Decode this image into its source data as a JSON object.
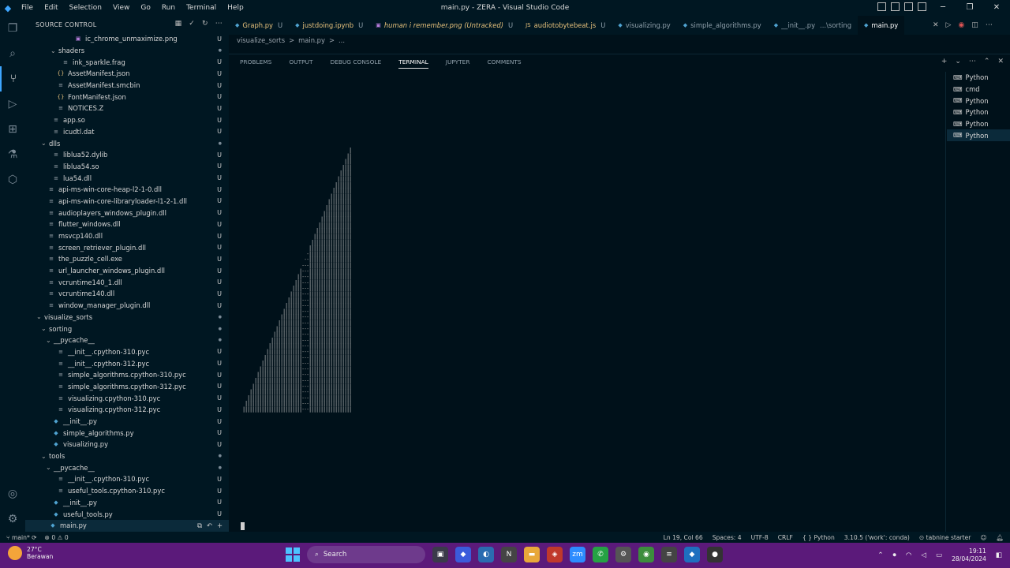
{
  "titlebar": {
    "title": "main.py - ZERA - Visual Studio Code",
    "menu": [
      "File",
      "Edit",
      "Selection",
      "View",
      "Go",
      "Run",
      "Terminal",
      "Help"
    ]
  },
  "sidebar": {
    "header": "SOURCE CONTROL",
    "items": [
      {
        "label": "ic_chrome_unmaximize.png",
        "indent": 52,
        "chev": "",
        "icon": "img",
        "status": "U"
      },
      {
        "label": "shaders",
        "indent": 32,
        "chev": "v",
        "icon": "",
        "status": "dot"
      },
      {
        "label": "ink_sparkle.frag",
        "indent": 36,
        "chev": "",
        "icon": "file",
        "status": "U"
      },
      {
        "label": "AssetManifest.json",
        "indent": 30,
        "chev": "",
        "icon": "json",
        "status": "U"
      },
      {
        "label": "AssetManifest.smcbin",
        "indent": 30,
        "chev": "",
        "icon": "file",
        "status": "U"
      },
      {
        "label": "FontManifest.json",
        "indent": 30,
        "chev": "",
        "icon": "json",
        "status": "U"
      },
      {
        "label": "NOTICES.Z",
        "indent": 30,
        "chev": "",
        "icon": "file",
        "status": "U"
      },
      {
        "label": "app.so",
        "indent": 24,
        "chev": "",
        "icon": "file",
        "status": "U"
      },
      {
        "label": "icudtl.dat",
        "indent": 24,
        "chev": "",
        "icon": "file",
        "status": "U"
      },
      {
        "label": "dlls",
        "indent": 20,
        "chev": "v",
        "icon": "",
        "status": "dot"
      },
      {
        "label": "liblua52.dylib",
        "indent": 24,
        "chev": "",
        "icon": "file",
        "status": "U"
      },
      {
        "label": "liblua54.so",
        "indent": 24,
        "chev": "",
        "icon": "file",
        "status": "U"
      },
      {
        "label": "lua54.dll",
        "indent": 24,
        "chev": "",
        "icon": "file",
        "status": "U"
      },
      {
        "label": "api-ms-win-core-heap-l2-1-0.dll",
        "indent": 18,
        "chev": "",
        "icon": "file",
        "status": "U"
      },
      {
        "label": "api-ms-win-core-libraryloader-l1-2-1.dll",
        "indent": 18,
        "chev": "",
        "icon": "file",
        "status": "U"
      },
      {
        "label": "audioplayers_windows_plugin.dll",
        "indent": 18,
        "chev": "",
        "icon": "file",
        "status": "U"
      },
      {
        "label": "flutter_windows.dll",
        "indent": 18,
        "chev": "",
        "icon": "file",
        "status": "U"
      },
      {
        "label": "msvcp140.dll",
        "indent": 18,
        "chev": "",
        "icon": "file",
        "status": "U"
      },
      {
        "label": "screen_retriever_plugin.dll",
        "indent": 18,
        "chev": "",
        "icon": "file",
        "status": "U"
      },
      {
        "label": "the_puzzle_cell.exe",
        "indent": 18,
        "chev": "",
        "icon": "file",
        "status": "U"
      },
      {
        "label": "url_launcher_windows_plugin.dll",
        "indent": 18,
        "chev": "",
        "icon": "file",
        "status": "U"
      },
      {
        "label": "vcruntime140_1.dll",
        "indent": 18,
        "chev": "",
        "icon": "file",
        "status": "U"
      },
      {
        "label": "vcruntime140.dll",
        "indent": 18,
        "chev": "",
        "icon": "file",
        "status": "U"
      },
      {
        "label": "window_manager_plugin.dll",
        "indent": 18,
        "chev": "",
        "icon": "file",
        "status": "U"
      },
      {
        "label": "visualize_sorts",
        "indent": 14,
        "chev": "v",
        "icon": "",
        "status": "dot"
      },
      {
        "label": "sorting",
        "indent": 20,
        "chev": "v",
        "icon": "",
        "status": "dot"
      },
      {
        "label": "__pycache__",
        "indent": 26,
        "chev": "v",
        "icon": "",
        "status": "dot"
      },
      {
        "label": "__init__.cpython-310.pyc",
        "indent": 30,
        "chev": "",
        "icon": "file",
        "status": "U"
      },
      {
        "label": "__init__.cpython-312.pyc",
        "indent": 30,
        "chev": "",
        "icon": "file",
        "status": "U"
      },
      {
        "label": "simple_algorithms.cpython-310.pyc",
        "indent": 30,
        "chev": "",
        "icon": "file",
        "status": "U"
      },
      {
        "label": "simple_algorithms.cpython-312.pyc",
        "indent": 30,
        "chev": "",
        "icon": "file",
        "status": "U"
      },
      {
        "label": "visualizing.cpython-310.pyc",
        "indent": 30,
        "chev": "",
        "icon": "file",
        "status": "U"
      },
      {
        "label": "visualizing.cpython-312.pyc",
        "indent": 30,
        "chev": "",
        "icon": "file",
        "status": "U"
      },
      {
        "label": "__init__.py",
        "indent": 24,
        "chev": "",
        "icon": "py",
        "status": "U"
      },
      {
        "label": "simple_algorithms.py",
        "indent": 24,
        "chev": "",
        "icon": "py",
        "status": "U"
      },
      {
        "label": "visualizing.py",
        "indent": 24,
        "chev": "",
        "icon": "py",
        "status": "U"
      },
      {
        "label": "tools",
        "indent": 20,
        "chev": "v",
        "icon": "",
        "status": "dot"
      },
      {
        "label": "__pycache__",
        "indent": 26,
        "chev": "v",
        "icon": "",
        "status": "dot"
      },
      {
        "label": "__init__.cpython-310.pyc",
        "indent": 30,
        "chev": "",
        "icon": "file",
        "status": "U"
      },
      {
        "label": "useful_tools.cpython-310.pyc",
        "indent": 30,
        "chev": "",
        "icon": "file",
        "status": "U"
      },
      {
        "label": "__init__.py",
        "indent": 24,
        "chev": "",
        "icon": "py",
        "status": "U"
      },
      {
        "label": "useful_tools.py",
        "indent": 24,
        "chev": "",
        "icon": "py",
        "status": "U"
      },
      {
        "label": "main.py",
        "indent": 20,
        "chev": "",
        "icon": "py",
        "status": "",
        "selected": true
      }
    ]
  },
  "tabs": [
    {
      "label": "Graph.py",
      "status": "U",
      "icon": "py",
      "italic": false
    },
    {
      "label": "justdoing.ipynb",
      "status": "U",
      "icon": "nb",
      "italic": false
    },
    {
      "label": "human i remember.png (Untracked)",
      "status": "U",
      "icon": "img",
      "italic": true
    },
    {
      "label": "audiotobytebeat.js",
      "status": "U",
      "icon": "js",
      "italic": false
    },
    {
      "label": "visualizing.py",
      "status": "",
      "icon": "py",
      "italic": false
    },
    {
      "label": "simple_algorithms.py",
      "status": "",
      "icon": "py",
      "italic": false
    },
    {
      "label": "__init__.py",
      "status": "...\\sorting",
      "icon": "py",
      "italic": false
    },
    {
      "label": "main.py",
      "status": "",
      "icon": "py",
      "italic": false,
      "active": true
    }
  ],
  "breadcrumb": [
    "visualize_sorts",
    ">",
    "main.py",
    ">",
    "..."
  ],
  "panel": {
    "tabs": [
      "PROBLEMS",
      "OUTPUT",
      "DEBUG CONSOLE",
      "TERMINAL",
      "JUPYTER",
      "COMMENTS"
    ],
    "active_tab": "TERMINAL",
    "terminals": [
      {
        "label": "Python",
        "selected": false
      },
      {
        "label": "cmd",
        "selected": false
      },
      {
        "label": "Python",
        "selected": false
      },
      {
        "label": "Python",
        "selected": false
      },
      {
        "label": "Python",
        "selected": false
      },
      {
        "label": "Python",
        "selected": true
      }
    ]
  },
  "terminal_viz": {
    "bar_char": "|",
    "bar_heights": [
      1,
      2,
      3,
      4,
      5,
      6,
      7,
      8,
      9,
      10,
      11,
      12,
      13,
      14,
      15,
      16,
      17,
      18,
      19,
      20,
      21,
      22,
      23,
      24,
      25,
      26,
      27,
      28,
      29,
      30,
      31,
      32,
      33,
      34,
      35,
      36,
      37,
      38,
      39,
      40,
      41,
      42,
      43,
      44,
      45,
      46
    ],
    "highlight_columns": [
      25,
      26,
      27
    ]
  },
  "statusbar": {
    "branch": "main*",
    "problems": "0",
    "warnings": "0",
    "position": "Ln 19, Col 66",
    "spaces": "Spaces: 4",
    "encoding": "UTF-8",
    "eol": "CRLF",
    "language": "Python",
    "interpreter": "3.10.5 ('work': conda)",
    "tabnine": "tabnine starter"
  },
  "taskbar": {
    "temperature": "27°C",
    "weather": "Berawan",
    "search_label": "Search",
    "time": "19:11",
    "date": "28/04/2024"
  },
  "colors": {
    "accent": "#3ea6ff",
    "background": "#00111a",
    "taskbar": "#5b1a7a"
  }
}
